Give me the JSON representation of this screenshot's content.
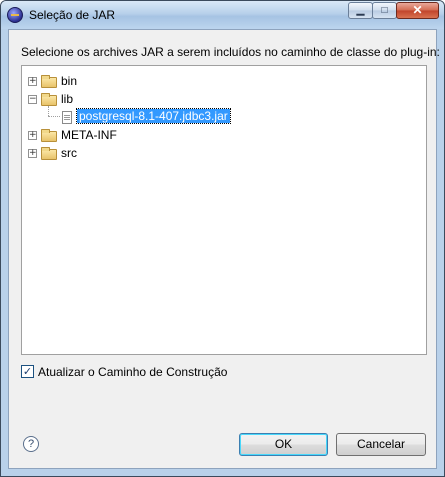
{
  "window": {
    "title": "Seleção de JAR",
    "min_label": "▁",
    "max_label": "□",
    "close_label": "✕"
  },
  "instruction": "Selecione os archives JAR a serem incluídos no caminho de classe do plug-in:",
  "tree": {
    "items": [
      {
        "label": "bin",
        "kind": "folder",
        "expander": "+"
      },
      {
        "label": "lib",
        "kind": "folder",
        "expander": "−"
      },
      {
        "label": "postgresql-8.1-407.jdbc3.jar",
        "kind": "file",
        "selected": true
      },
      {
        "label": "META-INF",
        "kind": "folder",
        "expander": "+"
      },
      {
        "label": "src",
        "kind": "folder",
        "expander": "+"
      }
    ]
  },
  "update_build_path": {
    "label": "Atualizar o Caminho de Construção",
    "checked": true,
    "check_glyph": "✓"
  },
  "help_glyph": "?",
  "buttons": {
    "ok": "OK",
    "cancel": "Cancelar"
  }
}
